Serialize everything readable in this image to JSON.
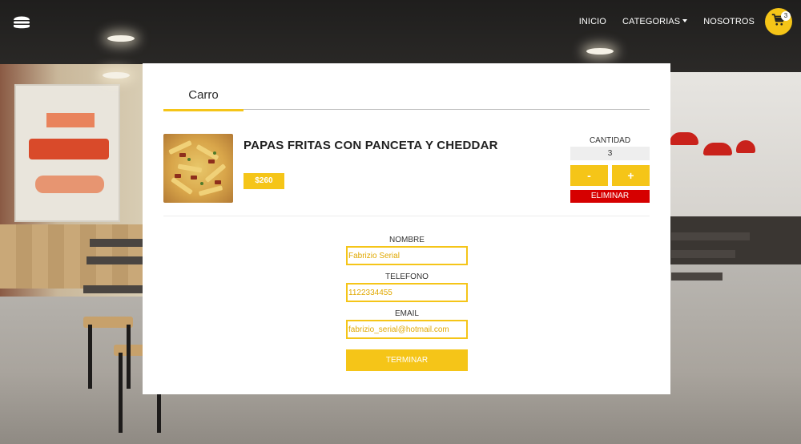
{
  "header": {
    "logo_icon": "burger-icon",
    "nav": [
      {
        "label": "INICIO"
      },
      {
        "label": "CATEGORIAS",
        "has_dropdown": true
      },
      {
        "label": "NOSOTROS"
      }
    ],
    "cart": {
      "icon": "shopping-cart-icon",
      "count": "3"
    }
  },
  "cart_panel": {
    "tab_label": "Carro",
    "items": [
      {
        "name": "PAPAS FRITAS CON PANCETA Y CHEDDAR",
        "price": "$260",
        "quantity_label": "CANTIDAD",
        "quantity": "3",
        "minus_label": "-",
        "plus_label": "+",
        "delete_label": "ELIMINAR"
      }
    ]
  },
  "form": {
    "name_label": "NOMBRE",
    "name_value": "Fabrizio Serial",
    "phone_label": "TELEFONO",
    "phone_value": "1122334455",
    "email_label": "EMAIL",
    "email_value": "fabrizio_serial@hotmail.com",
    "submit_label": "TERMINAR"
  },
  "colors": {
    "accent": "#f5c518",
    "danger": "#d60000",
    "panel_bg": "#ffffff"
  }
}
